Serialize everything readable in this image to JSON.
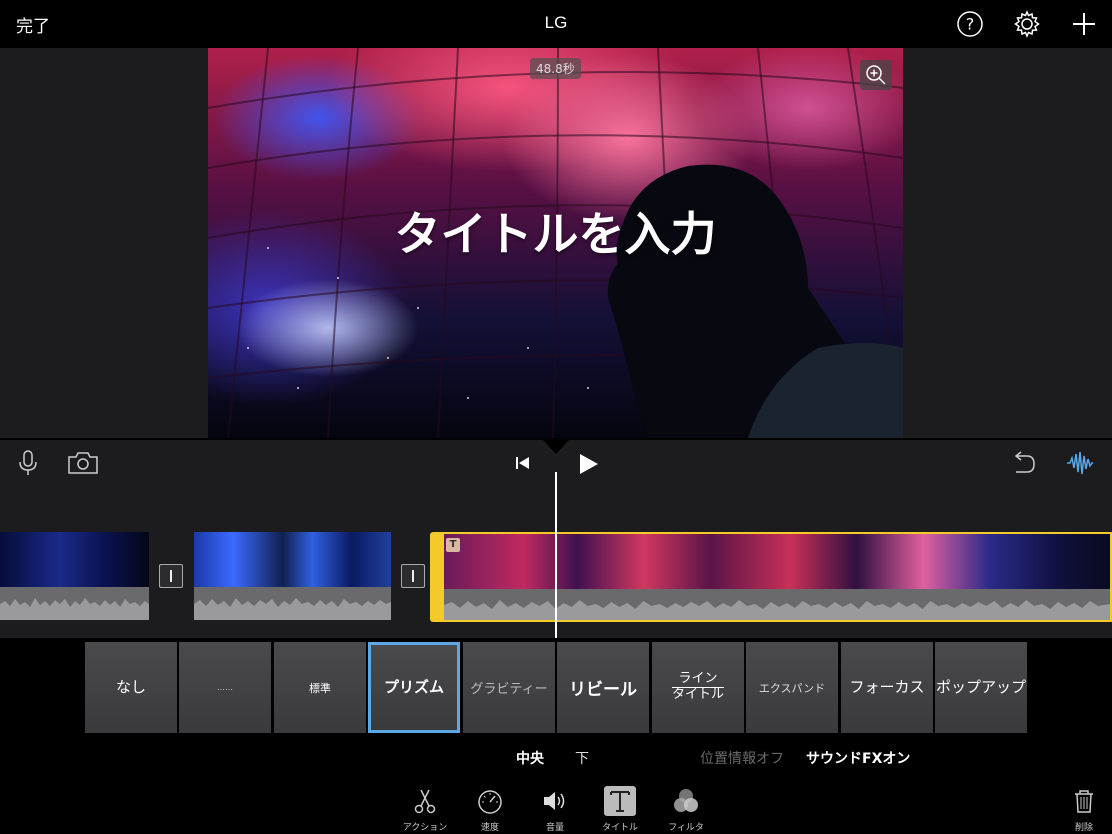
{
  "header": {
    "done_label": "完了",
    "project_title": "LG"
  },
  "viewer": {
    "duration": "48.8秒",
    "title_text": "タイトルを入力"
  },
  "title_styles": [
    {
      "label": "なし"
    },
    {
      "label": "……"
    },
    {
      "label": "標準"
    },
    {
      "label": "プリズム",
      "selected": true
    },
    {
      "label": "グラビティー"
    },
    {
      "label": "リビール"
    },
    {
      "label_line1": "ライン",
      "label_line2": "タイトル"
    },
    {
      "label": "エクスパンド"
    },
    {
      "label": "フォーカス"
    },
    {
      "label": "ポップアップ"
    }
  ],
  "options": {
    "center": "中央",
    "bottom": "下",
    "location": "位置情報オフ",
    "sound_fx": "サウンドFXオン"
  },
  "tools": [
    {
      "label": "アクション",
      "icon": "scissors-icon"
    },
    {
      "label": "速度",
      "icon": "speedometer-icon"
    },
    {
      "label": "音量",
      "icon": "speaker-icon"
    },
    {
      "label": "タイトル",
      "icon": "title-t-icon",
      "selected": true
    },
    {
      "label": "フィルタ",
      "icon": "filter-circles-icon"
    }
  ],
  "delete_label": "削除",
  "colors": {
    "accent_selection": "#5aa8e6",
    "clip_selected": "#f4c92a"
  }
}
